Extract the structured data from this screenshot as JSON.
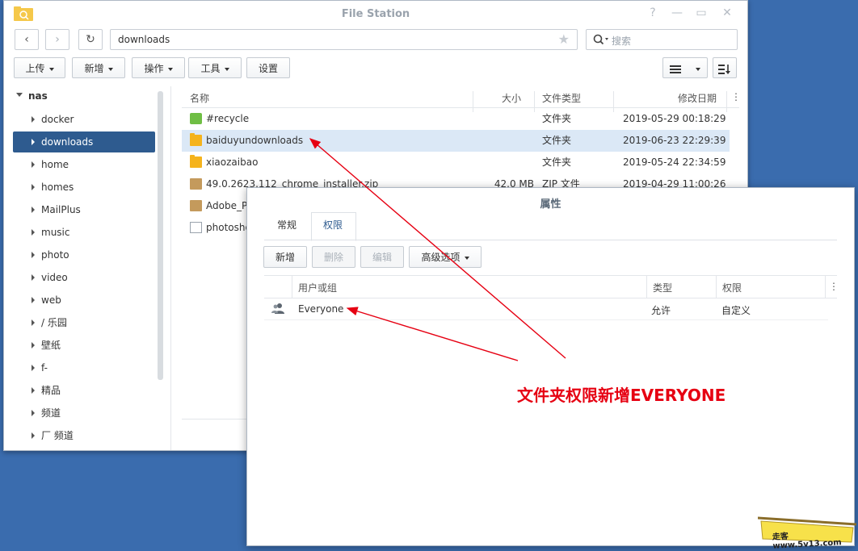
{
  "window": {
    "title": "File Station",
    "controls": {
      "help": "?",
      "minimize": "—",
      "maximize": "▭",
      "close": "✕"
    }
  },
  "toolbar": {
    "back": "‹",
    "forward": "›",
    "refresh": "↻",
    "path": "downloads",
    "search_placeholder": "搜索",
    "buttons": {
      "upload": "上传",
      "create": "新增",
      "action": "操作",
      "tools": "工具",
      "settings": "设置"
    }
  },
  "tree": {
    "root": "nas",
    "items": [
      "docker",
      "downloads",
      "home",
      "homes",
      "MailPlus",
      "music",
      "photo",
      "video",
      "web",
      "/ 乐园",
      "壁纸",
      "f- ",
      "精品",
      "频道",
      "厂  频道"
    ],
    "selected": "downloads"
  },
  "grid": {
    "columns": {
      "name": "名称",
      "size": "大小",
      "type": "文件类型",
      "modified": "修改日期"
    },
    "rows": [
      {
        "name": "#recycle",
        "size": "",
        "type": "文件夹",
        "modified": "2019-05-29 00:18:29",
        "icon": "recycle-folder-icon"
      },
      {
        "name": "baiduyundownloads",
        "size": "",
        "type": "文件夹",
        "modified": "2019-06-23 22:29:39",
        "icon": "folder-icon"
      },
      {
        "name": "xiaozaibao",
        "size": "",
        "type": "文件夹",
        "modified": "2019-05-24 22:34:59",
        "icon": "folder-icon"
      },
      {
        "name": "49.0.2623.112_chrome_installer.zip",
        "size": "42.0 MB",
        "type": "ZIP 文件",
        "modified": "2019-04-29 11:00:26",
        "icon": "zip-icon"
      },
      {
        "name": "Adobe_P",
        "size": "",
        "type": "",
        "modified": "",
        "icon": "zip-icon"
      },
      {
        "name": "photosho",
        "size": "",
        "type": "",
        "modified": "",
        "icon": "file-icon"
      }
    ]
  },
  "properties": {
    "title": "属性",
    "tabs": [
      "常规",
      "权限"
    ],
    "active_tab": "权限",
    "buttons": {
      "create": "新增",
      "delete": "删除",
      "edit": "编辑",
      "advanced": "高级选项"
    },
    "columns": {
      "user": "用户或组",
      "type": "类型",
      "permission": "权限"
    },
    "rows": [
      {
        "user": "Everyone",
        "type": "允许",
        "permission": "自定义"
      }
    ]
  },
  "annotation": {
    "text": "文件夹权限新增EVERYONE",
    "color": "#e60012"
  },
  "watermark": {
    "text": "走客 www.5v13.com"
  },
  "colors": {
    "desktop": "#3a6cae",
    "selection": "#2e5b8f",
    "row_highlight": "#dbe8f6",
    "arrow": "#e60012"
  }
}
